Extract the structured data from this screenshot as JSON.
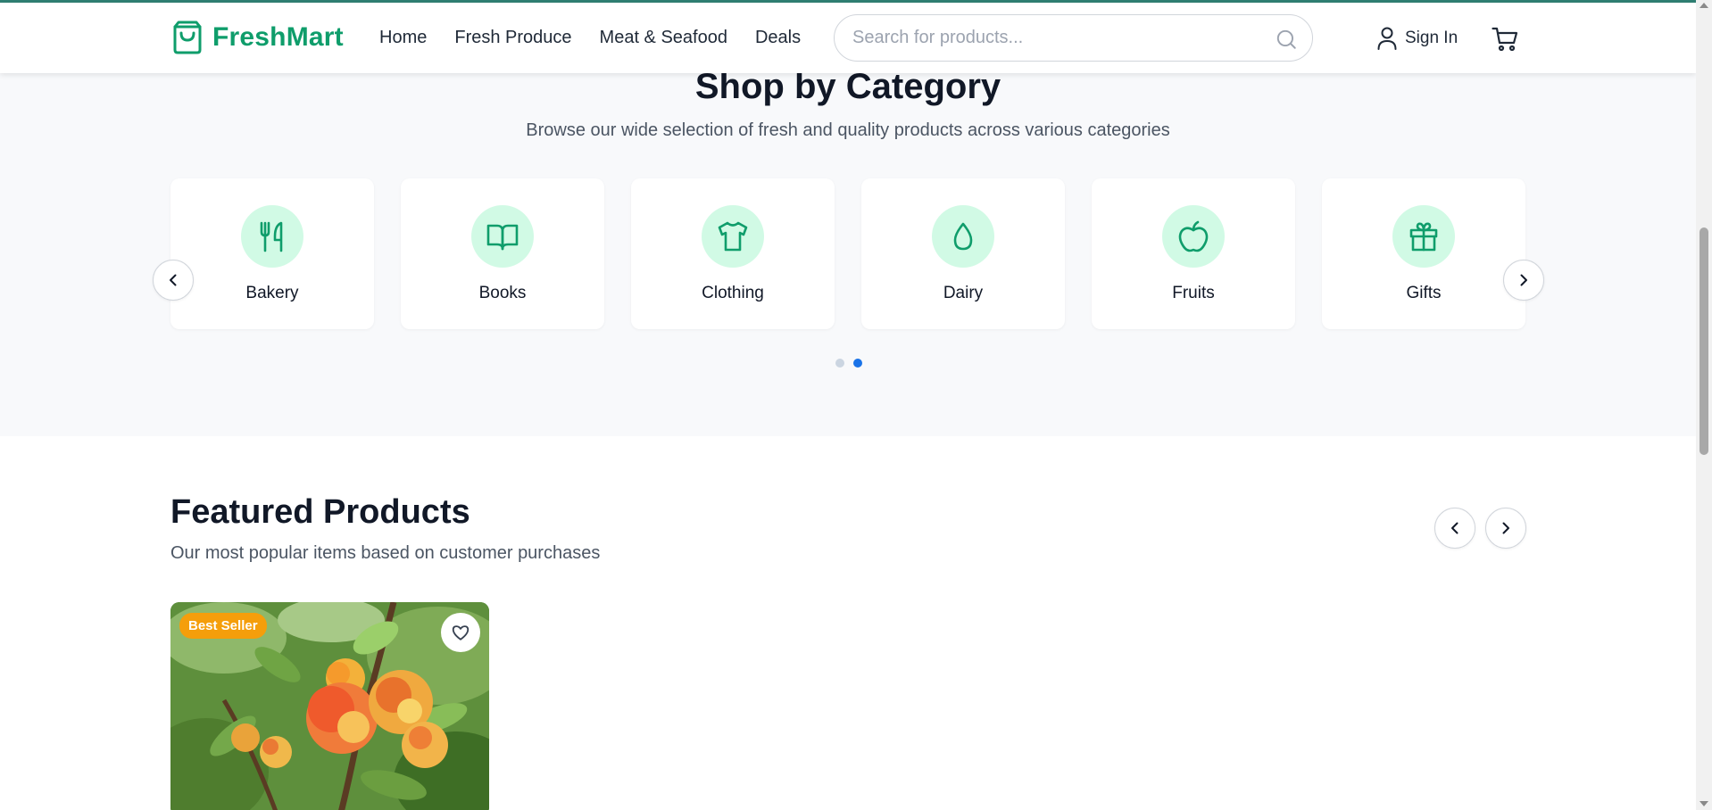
{
  "brand": {
    "name": "FreshMart",
    "color": "#0f9d6b"
  },
  "nav": {
    "links": [
      "Home",
      "Fresh Produce",
      "Meat & Seafood",
      "Deals"
    ],
    "search_placeholder": "Search for products...",
    "signin_label": "Sign In"
  },
  "categories": {
    "title": "Shop by Category",
    "subtitle": "Browse our wide selection of fresh and quality products across various categories",
    "items": [
      {
        "label": "Bakery",
        "icon": "utensils-icon"
      },
      {
        "label": "Books",
        "icon": "book-open-icon"
      },
      {
        "label": "Clothing",
        "icon": "shirt-icon"
      },
      {
        "label": "Dairy",
        "icon": "droplet-icon"
      },
      {
        "label": "Fruits",
        "icon": "apple-icon"
      },
      {
        "label": "Gifts",
        "icon": "gift-icon"
      }
    ],
    "pagination": {
      "pages": 2,
      "active_page": 2
    }
  },
  "featured": {
    "title": "Featured Products",
    "subtitle": "Our most popular items based on customer purchases",
    "products": [
      {
        "badge": "Best Seller"
      }
    ]
  },
  "colors": {
    "accent_green": "#0f9d6b",
    "icon_bg": "#d1fae5",
    "badge_orange": "#f59e0b",
    "active_dot": "#1a73e8"
  }
}
